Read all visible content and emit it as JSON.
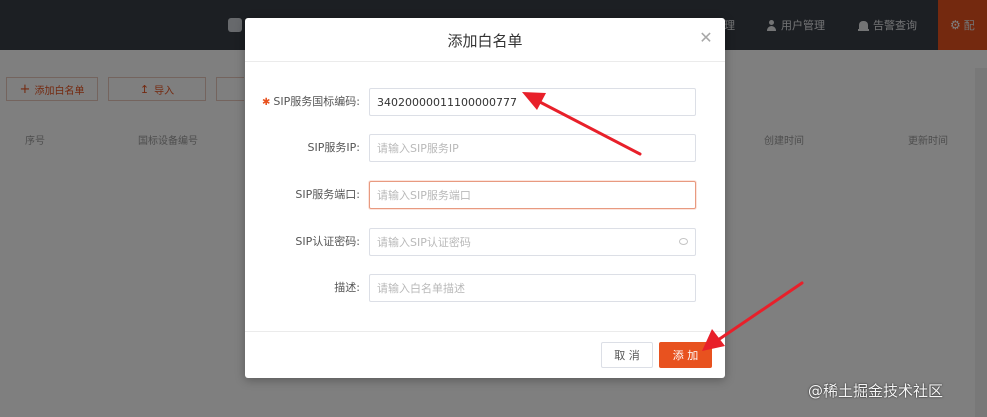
{
  "topnav": {
    "partial_label": "理",
    "user_management": "用户管理",
    "alarm_query": "告警查询",
    "config_partial": "配",
    "accent_color": "#e8521f"
  },
  "toolbar": {
    "add_whitelist": "添加白名单",
    "import": "导入"
  },
  "table": {
    "columns": [
      "序号",
      "国标设备编号",
      "创建时间",
      "更新时间"
    ]
  },
  "modal": {
    "title": "添加白名单",
    "close_icon": "close-icon",
    "fields": [
      {
        "label": "SIP服务国标编码:",
        "required": true,
        "value": "34020000011100000777",
        "placeholder": ""
      },
      {
        "label": "SIP服务IP:",
        "required": false,
        "value": "",
        "placeholder": "请输入SIP服务IP"
      },
      {
        "label": "SIP服务端口:",
        "required": false,
        "value": "",
        "placeholder": "请输入SIP服务端口"
      },
      {
        "label": "SIP认证密码:",
        "required": false,
        "value": "",
        "placeholder": "请输入SIP认证密码"
      },
      {
        "label": "描述:",
        "required": false,
        "value": "",
        "placeholder": "请输入白名单描述"
      }
    ],
    "cancel_label": "取 消",
    "submit_label": "添 加"
  },
  "annotation": {
    "arrow_color": "#e8202a"
  },
  "watermark": "@稀土掘金技术社区"
}
